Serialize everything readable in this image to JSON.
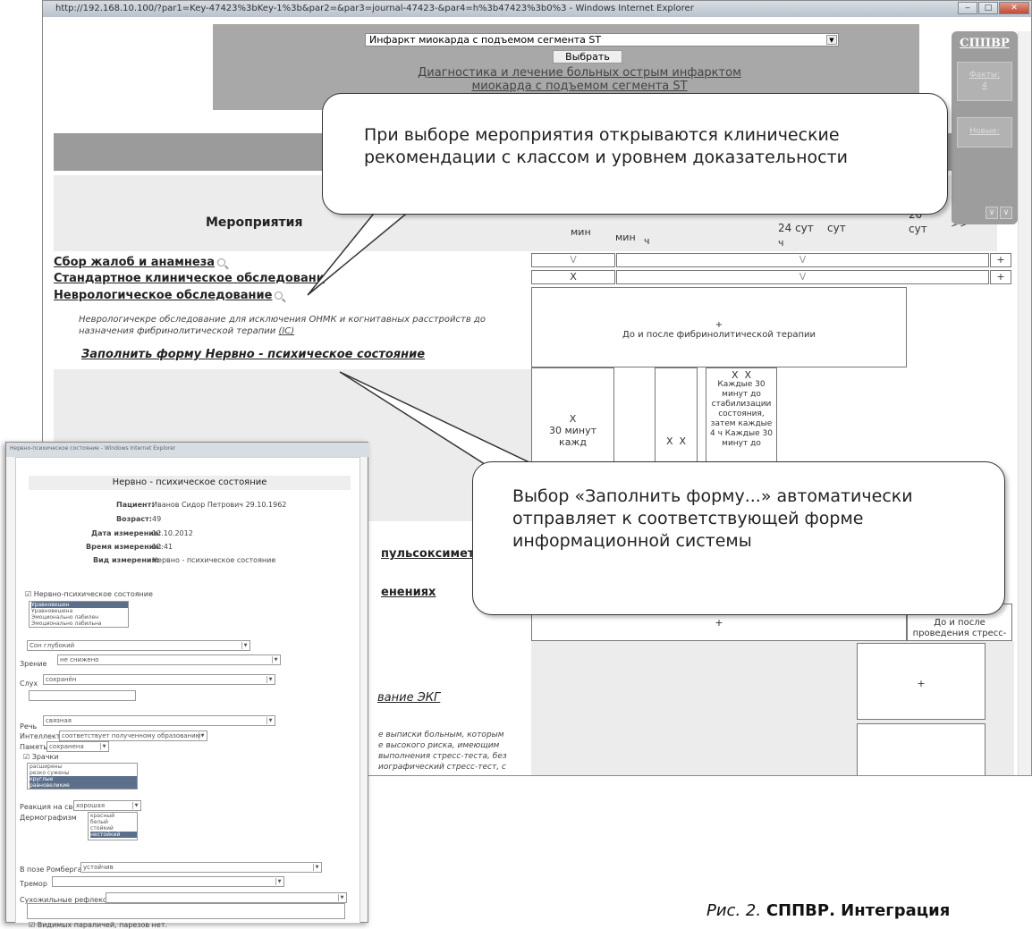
{
  "browser": {
    "title": "http://192.168.10.100/?par1=Key-47423%3bKey-1%3b&par2=&par3=journal-47423-&par4=h%3b47423%3b0%3 - Windows Internet Explorer",
    "btn_min": "‒",
    "btn_max": "□",
    "btn_close": "✕"
  },
  "top": {
    "disease_select": "Инфаркт миокарда с подъемом сегмента ST",
    "select_button": "Выбрать",
    "guideline_link_line1": "Диагностика и лечение больных острым инфарктом",
    "guideline_link_line2": "миокарда с подъемом сегмента ST"
  },
  "sidebar": {
    "title": "СППВР",
    "facts_label": "Факты:",
    "facts_count": "4",
    "new_label": "Новые:",
    "btn1": "∨",
    "btn2": "∨"
  },
  "table": {
    "header_measures": "Мероприятия",
    "time_cols": [
      "мин",
      "мин",
      "ч",
      "24 сут",
      "ч",
      "сут",
      "20",
      "сут",
      ">>"
    ],
    "rows": {
      "complaints": "Сбор жалоб и анамнеза",
      "clinical": "Стандартное клиническое обследовани",
      "neuro": "Неврологическое обследование",
      "neuro_desc_1": "Неврологичекре обследование для исключения ОНМК и когнитавных расстройств до",
      "neuro_desc_2": "назначения фибринолитической терапии",
      "neuro_desc_ref": "(IC)",
      "fill_form": "Заполнить форму Нервно - психическое состояние",
      "neuro_cell": "До и после фибринолитической терапии",
      "plus": "+",
      "pulse": "пульсоксиметр",
      "changes": "енениях",
      "ecg": "вание ЭКГ",
      "stress": "До и после проведения стресс-теста",
      "stress_text_1": "е выписки больным, которым",
      "stress_text_2": "е высокого риска, имеющим",
      "stress_text_3": "выполнения стресс-теста, без",
      "stress_text_4": "иографический стресс-тест, с"
    },
    "marks": {
      "v": "V",
      "x": "X",
      "every30": "Каждые 30 минут до стабилизации состояния, затем каждые 4 ч Каждые 30 минут до",
      "x30": "30 минут",
      "kazh": "кажд"
    }
  },
  "callouts": {
    "top": "При выборе мероприятия открываются клинические рекомендации с классом и уровнем доказательности",
    "bottom": "Выбор «Заполнить форму...» автоматически отправляет к соответствующей форме информационной системы"
  },
  "form": {
    "window_title": "Нервно-психическое состояние - Windows Internet Explorer",
    "heading": "Нервно - психическое состояние",
    "patient_label": "Пациент:",
    "patient": "Иванов Сидор Петрович 29.10.1962",
    "age_label": "Возраст:",
    "age": "49",
    "date_label": "Дата измерения:",
    "date": "12.10.2012",
    "time_label": "Время измерения:",
    "time": "12:41",
    "kind_label": "Вид измерения:",
    "kind": "Нервно - психическое состояние",
    "np_label": "Нервно-психическое состояние",
    "np_options": [
      "Уравновешен",
      "Уравновешена",
      "Эмоционально лабилен",
      "Эмоционально лабильна"
    ],
    "sleep": "Сон глубокий",
    "vision_label": "Зрение",
    "vision": "не снижено",
    "hearing_label": "Слух",
    "hearing": "сохранён",
    "speech_label": "Речь",
    "speech": "связная",
    "intellect_label": "Интеллект",
    "intellect": "соответствует полученному образованию",
    "memory_label": "Память",
    "memory": "сохранена",
    "pupils_label": "Зрачки",
    "pupils_options": [
      "расширены",
      "резко сужены",
      "круглые",
      "равновеликие"
    ],
    "light_label": "Реакция на свет",
    "light": "хорошая",
    "dermo_label": "Дермографизм",
    "dermo_options": [
      "красный",
      "белый",
      "стойкий",
      "нестойкий"
    ],
    "romberg_label": "В позе Ромберга",
    "romberg": "устойчив",
    "tremor_label": "Тремор",
    "tendon_label": "Сухожильные рефлексы",
    "paralysis": "Видимых параличей, парезов нет."
  },
  "caption": {
    "prefix": "Рис. 2.",
    "bold": "СППВР. Интеграция"
  }
}
